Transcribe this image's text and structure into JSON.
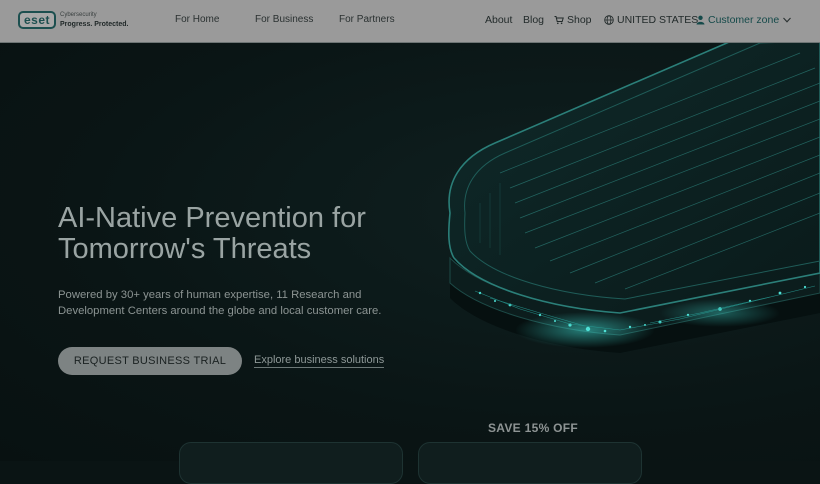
{
  "header": {
    "logo_text": "eset",
    "logo_tagline_1": "Cybersecurity",
    "logo_tagline_2": "Progress. Protected.",
    "nav": [
      "For Home",
      "For Business",
      "For Partners"
    ],
    "about": "About",
    "blog": "Blog",
    "shop": "Shop",
    "region": "UNITED STATES",
    "customer_zone": "Customer zone"
  },
  "hero": {
    "title_line1": "AI-Native Prevention for",
    "title_line2": "Tomorrow's Threats",
    "subtitle": "Powered by 30+ years of human expertise, 11 Research and Development Centers around the globe and local customer care.",
    "cta_label": "REQUEST BUSINESS TRIAL",
    "explore_label": "Explore business solutions"
  },
  "promo": {
    "save_label": "SAVE 15% OFF"
  },
  "colors": {
    "brand": "#154a4a",
    "accent": "#2fb8b0",
    "background": "#0a1414"
  }
}
